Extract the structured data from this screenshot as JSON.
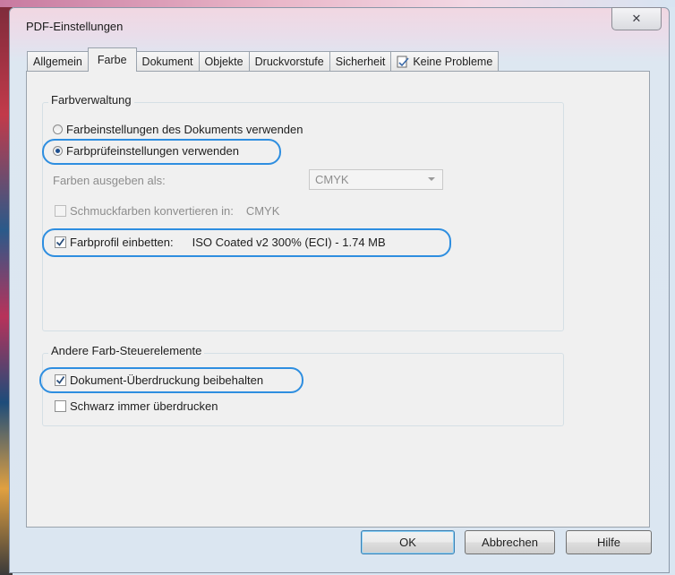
{
  "window": {
    "title": "PDF-Einstellungen",
    "close_glyph": "✕"
  },
  "tabs": [
    {
      "label": "Allgemein"
    },
    {
      "label": "Farbe",
      "active": true
    },
    {
      "label": "Dokument"
    },
    {
      "label": "Objekte"
    },
    {
      "label": "Druckvorstufe"
    },
    {
      "label": "Sicherheit"
    },
    {
      "label": "Keine Probleme",
      "icon": "document-check-icon"
    }
  ],
  "farbverwaltung": {
    "title": "Farbverwaltung",
    "radio_dokument": {
      "label": "Farbeinstellungen des Dokuments verwenden",
      "checked": false
    },
    "radio_farbpruef": {
      "label": "Farbprüfeinstellungen verwenden",
      "checked": true
    },
    "farben_ausgeben": {
      "label": "Farben ausgeben als:",
      "value": "CMYK"
    },
    "schmuckfarben": {
      "label": "Schmuckfarben konvertieren in:",
      "value": "CMYK",
      "checked": false
    },
    "farbprofil": {
      "label": "Farbprofil einbetten:",
      "value": "ISO Coated v2 300% (ECI) - 1.74 MB",
      "checked": true
    }
  },
  "andere": {
    "title": "Andere Farb-Steuerelemente",
    "ueberdruckung": {
      "label": "Dokument-Überdruckung beibehalten",
      "checked": true
    },
    "schwarz": {
      "label": "Schwarz immer überdrucken",
      "checked": false
    }
  },
  "buttons": {
    "ok": "OK",
    "abbrechen": "Abbrechen",
    "hilfe": "Hilfe"
  },
  "colors": {
    "highlight": "#2e8ee0",
    "radio_dot": "#1d4f8f",
    "check_mark": "#2b4f7c"
  }
}
